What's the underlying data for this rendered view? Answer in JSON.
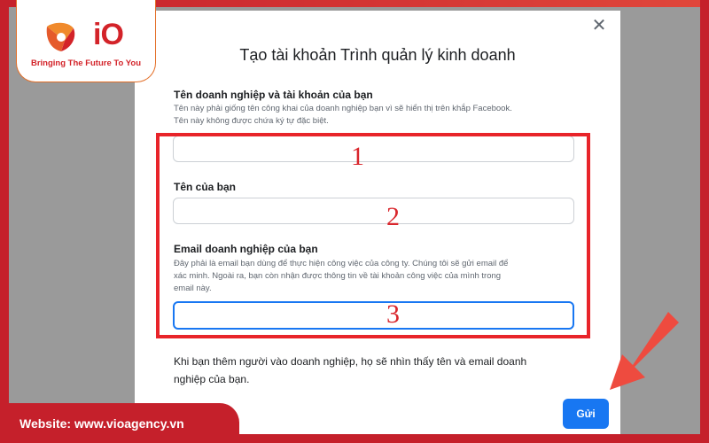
{
  "brand": {
    "logo_text": "iO",
    "tagline": "Bringing The Future To You",
    "website": "Website: www.vioagency.vn"
  },
  "dialog": {
    "title": "Tạo tài khoản Trình quản lý kinh doanh",
    "close_symbol": "✕",
    "business_name": {
      "label": "Tên doanh nghiệp và tài khoản của bạn",
      "help_line1": "Tên này phải giống tên công khai của doanh nghiệp bạn vì sẽ hiển thị trên khắp Facebook.",
      "help_line2": "Tên này không được chứa ký tự đặc biệt.",
      "value": ""
    },
    "your_name": {
      "label": "Tên của bạn",
      "value": ""
    },
    "business_email": {
      "label": "Email doanh nghiệp của bạn",
      "help_line1": "Đây phải là email bạn dùng để thực hiện công việc của công ty. Chúng tôi sẽ gửi email để",
      "help_line2": "xác minh. Ngoài ra, bạn còn nhận được thông tin về tài khoản công việc của mình trong",
      "help_line3": "email này.",
      "value": ""
    },
    "info_line1": "Khi bạn thêm người vào doanh nghiệp, họ sẽ nhìn thấy tên và email doanh",
    "info_line2": "nghiệp của bạn.",
    "submit_label": "Gửi"
  },
  "annotations": {
    "step1": "1",
    "step2": "2",
    "step3": "3"
  },
  "colors": {
    "brand_red": "#c5202b",
    "highlight_red": "#e8242a",
    "primary_blue": "#1877f2"
  },
  "icons": {
    "close": "close-icon",
    "arrow": "pointer-arrow-icon",
    "logo": "vio-logo-icon"
  }
}
